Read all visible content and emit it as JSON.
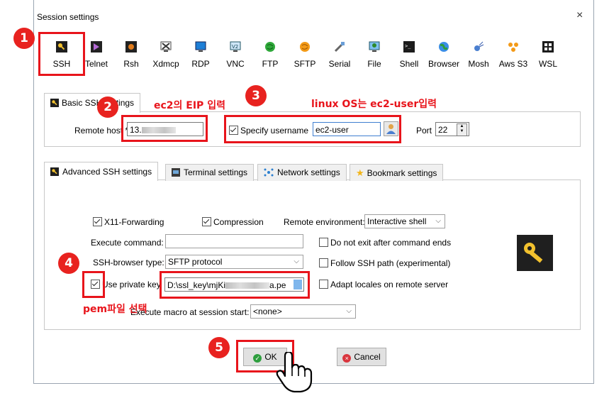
{
  "window": {
    "title": "Session settings",
    "close_symbol": "×"
  },
  "toolbar": {
    "items": [
      {
        "label": "SSH",
        "icon": "key-icon"
      },
      {
        "label": "Telnet",
        "icon": "telnet-icon"
      },
      {
        "label": "Rsh",
        "icon": "rsh-icon"
      },
      {
        "label": "Xdmcp",
        "icon": "xdmcp-icon"
      },
      {
        "label": "RDP",
        "icon": "rdp-icon"
      },
      {
        "label": "VNC",
        "icon": "vnc-icon"
      },
      {
        "label": "FTP",
        "icon": "ftp-icon"
      },
      {
        "label": "SFTP",
        "icon": "sftp-icon"
      },
      {
        "label": "Serial",
        "icon": "serial-icon"
      },
      {
        "label": "File",
        "icon": "file-icon"
      },
      {
        "label": "Shell",
        "icon": "shell-icon"
      },
      {
        "label": "Browser",
        "icon": "browser-icon"
      },
      {
        "label": "Mosh",
        "icon": "mosh-icon"
      },
      {
        "label": "Aws S3",
        "icon": "aws-s3-icon"
      },
      {
        "label": "WSL",
        "icon": "wsl-icon"
      }
    ]
  },
  "basic_tab": {
    "label": "Basic SSH settings"
  },
  "basic": {
    "remote_host_label": "Remote host *",
    "remote_host_value": "13.",
    "specify_username_label": "Specify username",
    "username_value": "ec2-user",
    "port_label": "Port",
    "port_value": "22"
  },
  "adv_tabs": [
    {
      "label": "Advanced SSH settings"
    },
    {
      "label": "Terminal settings"
    },
    {
      "label": "Network settings"
    },
    {
      "label": "Bookmark settings"
    }
  ],
  "advanced": {
    "x11_label": "X11-Forwarding",
    "compression_label": "Compression",
    "remote_env_label": "Remote environment:",
    "remote_env_value": "Interactive shell",
    "exec_cmd_label": "Execute command:",
    "exec_cmd_value": "",
    "no_exit_label": "Do not exit after command ends",
    "browser_type_label": "SSH-browser type:",
    "browser_type_value": "SFTP protocol",
    "follow_path_label": "Follow SSH path (experimental)",
    "private_key_label": "Use private key",
    "private_key_value": "D:\\ssl_key\\mjKi",
    "private_key_suffix": "a.pe",
    "adapt_locales_label": "Adapt locales on remote server",
    "macro_label": "Execute macro at session start:",
    "macro_value": "<none>"
  },
  "buttons": {
    "ok": "OK",
    "cancel": "Cancel"
  },
  "annotations": {
    "n1": "1",
    "n2": "2",
    "n3": "3",
    "n4": "4",
    "n5": "5",
    "eip": "ec2의 EIP 입력",
    "linux": "linux OS는 ec2-user입력",
    "pem": "pem파일 선택"
  },
  "colors": {
    "annotation_red": "#e8141b",
    "badge_red": "#e8221f",
    "ok_green": "#2e9e3e",
    "cancel_red": "#d9363e"
  }
}
